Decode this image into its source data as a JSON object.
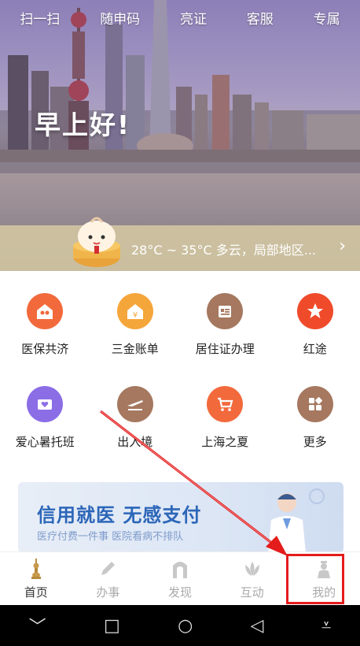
{
  "topnav": [
    "扫一扫",
    "随申码",
    "亮证",
    "客服",
    "专属"
  ],
  "greeting": "早上好!",
  "weather": {
    "text": "28°C ~ 35°C 多云，局部地区...",
    "arrow": "›"
  },
  "services": [
    {
      "label": "医保共济",
      "icon": "medical-insurance-icon",
      "color": "#f26a3c"
    },
    {
      "label": "三金账单",
      "icon": "yen-house-icon",
      "color": "#f5a63a"
    },
    {
      "label": "居住证办理",
      "icon": "id-card-icon",
      "color": "#a5785f"
    },
    {
      "label": "红途",
      "icon": "red-star-icon",
      "color": "#ef4b2b"
    },
    {
      "label": "爱心暑托班",
      "icon": "heart-card-icon",
      "color": "#8b6de6"
    },
    {
      "label": "出入境",
      "icon": "airplane-icon",
      "color": "#a5785f"
    },
    {
      "label": "上海之夏",
      "icon": "shopping-cart-icon",
      "color": "#f26a3c"
    },
    {
      "label": "更多",
      "icon": "more-grid-icon",
      "color": "#a5785f"
    }
  ],
  "banner": {
    "title": "信用就医 无感支付",
    "subtitle": "医疗付费一件事 医院看病不排队"
  },
  "tabs": [
    {
      "label": "首页",
      "icon": "home-tower-icon",
      "active": true
    },
    {
      "label": "办事",
      "icon": "pen-icon",
      "active": false
    },
    {
      "label": "发现",
      "icon": "discover-arch-icon",
      "active": false
    },
    {
      "label": "互动",
      "icon": "lotus-icon",
      "active": false
    },
    {
      "label": "我的",
      "icon": "profile-icon",
      "active": false
    }
  ],
  "system_nav": [
    "﹀",
    "□",
    "○",
    "◁",
    "⩡"
  ]
}
